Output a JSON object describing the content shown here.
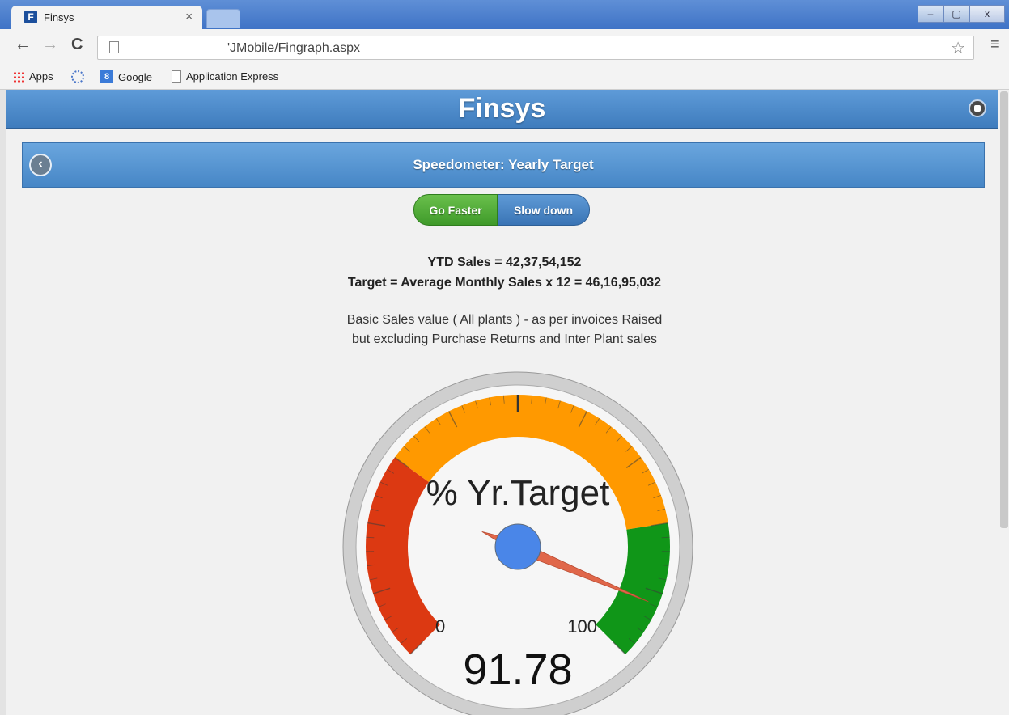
{
  "browser": {
    "tab_title": "Finsys",
    "tab_icon_letter": "F",
    "tab_close": "×",
    "url": "'JMobile/Fingraph.aspx",
    "window_min": "–",
    "window_max": "▢",
    "window_close": "x",
    "icons": {
      "back": "back-icon",
      "forward": "forward-icon",
      "reload": "reload-icon",
      "star": "star-icon",
      "menu": "menu-icon"
    },
    "bookmarks": [
      "Apps",
      "Google",
      "Application Express"
    ],
    "google_icon_letter": "8"
  },
  "app": {
    "title": "Finsys",
    "subheader": "Speedometer: Yearly Target"
  },
  "buttons": {
    "go_faster": "Go Faster",
    "slow_down": "Slow down"
  },
  "info": {
    "ytd": "YTD Sales = 42,37,54,152",
    "target": "Target = Average Monthly Sales x 12 = 46,16,95,032",
    "desc_line1": "Basic Sales value ( All plants ) - as per invoices Raised",
    "desc_line2": "but excluding Purchase Returns and Inter Plant sales"
  },
  "gauge": {
    "label": "% Yr.Target",
    "value": 91.78,
    "value_text": "91.78",
    "min": 0,
    "max": 100,
    "min_label": "0",
    "max_label": "100",
    "bands": [
      {
        "from": 0,
        "to": 30,
        "color": "#dc3912"
      },
      {
        "from": 30,
        "to": 80,
        "color": "#ff9900"
      },
      {
        "from": 80,
        "to": 100,
        "color": "#109618"
      }
    ],
    "needle_color": "#e0674a",
    "hub_color": "#4a86e8"
  }
}
